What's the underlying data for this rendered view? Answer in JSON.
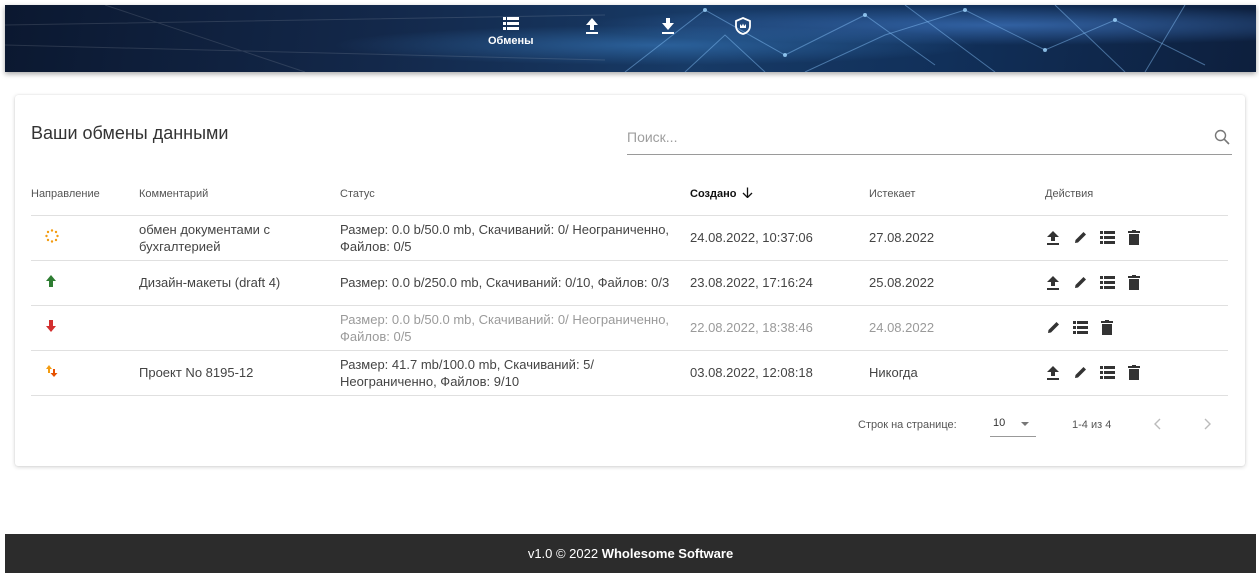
{
  "nav": {
    "items": [
      {
        "icon": "list-icon",
        "label": "Обмены"
      },
      {
        "icon": "upload-icon",
        "label": ""
      },
      {
        "icon": "download-icon",
        "label": ""
      },
      {
        "icon": "admin-shield-icon",
        "label": ""
      }
    ]
  },
  "card": {
    "title": "Ваши обмены данными",
    "search_placeholder": "Поиск..."
  },
  "table": {
    "headers": {
      "direction": "Направление",
      "comment": "Комментарий",
      "status": "Статус",
      "created": "Создано",
      "expires": "Истекает",
      "actions": "Действия"
    },
    "rows": [
      {
        "direction": "pending",
        "comment": "обмен документами с бухгалтерией",
        "status": "Размер: 0.0 b/50.0 mb, Скачиваний: 0/ Неограниченно, Файлов: 0/5",
        "created": "24.08.2022, 10:37:06",
        "expires": "27.08.2022",
        "actions": [
          "upload",
          "edit",
          "list",
          "delete"
        ]
      },
      {
        "direction": "upload",
        "comment": "Дизайн-макеты (draft 4)",
        "status": "Размер: 0.0 b/250.0 mb, Скачиваний: 0/10, Файлов: 0/3",
        "created": "23.08.2022, 17:16:24",
        "expires": "25.08.2022",
        "actions": [
          "upload",
          "edit",
          "list",
          "delete"
        ]
      },
      {
        "direction": "download",
        "comment": "",
        "status": "Размер: 0.0 b/50.0 mb, Скачиваний: 0/ Неограниченно, Файлов: 0/5",
        "created": "22.08.2022, 18:38:46",
        "expires": "24.08.2022",
        "actions": [
          "edit",
          "list",
          "delete"
        ]
      },
      {
        "direction": "bidirectional",
        "comment": "Проект No 8195-12",
        "status": "Размер: 41.7 mb/100.0 mb, Скачиваний: 5/ Неограниченно, Файлов: 9/10",
        "created": "03.08.2022, 12:08:18",
        "expires": "Никогда",
        "actions": [
          "upload",
          "edit",
          "list",
          "delete"
        ]
      }
    ]
  },
  "pagination": {
    "rows_per_page_label": "Строк на странице:",
    "rows_per_page_value": "10",
    "range": "1-4 из 4"
  },
  "footer": {
    "text_prefix": "v1.0 © 2022 ",
    "brand": "Wholesome Software"
  },
  "colors": {
    "upload_green": "#2e7d32",
    "download_red": "#d32f2f",
    "pending_orange": "#f39c12",
    "footer_bg": "#2c2c2c"
  }
}
